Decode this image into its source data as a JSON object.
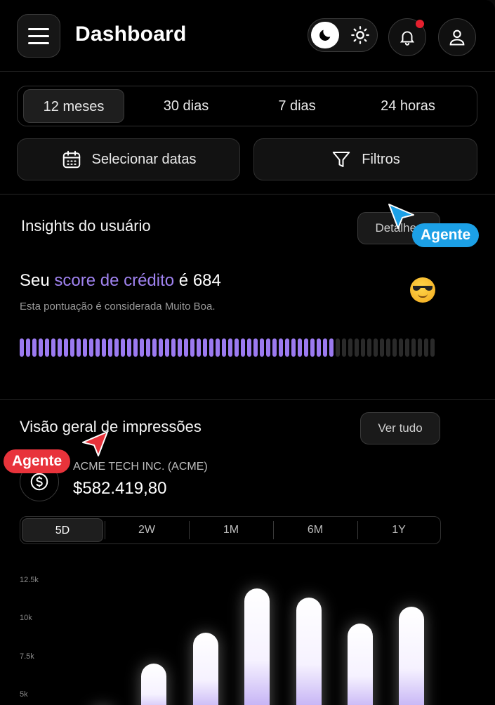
{
  "header": {
    "title": "Dashboard",
    "menu_icon": "hamburger-icon",
    "theme_icons": [
      "moon-icon",
      "sun-icon"
    ],
    "notification_icon": "bell-icon",
    "profile_icon": "user-icon"
  },
  "period_tabs": [
    {
      "label": "12 meses",
      "active": true
    },
    {
      "label": "30 dias",
      "active": false
    },
    {
      "label": "7 dias",
      "active": false
    },
    {
      "label": "24 horas",
      "active": false
    }
  ],
  "actions": {
    "select_dates": "Selecionar datas",
    "filters": "Filtros"
  },
  "insights": {
    "title": "Insights do usuário",
    "details_button": "Detalhes",
    "score_prefix": "Seu ",
    "score_highlight": "score de crédito",
    "score_suffix": " é 684",
    "score_description": "Esta pontuação é considerada Muito Boa.",
    "meter_filled_fraction": 0.76
  },
  "impressions": {
    "title": "Visão geral de impressões",
    "view_all_button": "Ver tudo",
    "company": "ACME TECH INC. (ACME)",
    "amount": "$582.419,80",
    "range_tabs": [
      {
        "label": "5D",
        "active": true
      },
      {
        "label": "2W",
        "active": false
      },
      {
        "label": "1M",
        "active": false
      },
      {
        "label": "6M",
        "active": false
      },
      {
        "label": "1Y",
        "active": false
      }
    ]
  },
  "chart_data": {
    "type": "bar",
    "y_ticks": [
      "12.5k",
      "10k",
      "7.5k",
      "5k"
    ],
    "ylim": [
      0,
      12500
    ],
    "values": [
      4100,
      6900,
      8900,
      11800,
      11200,
      9500,
      10600
    ]
  },
  "agents": [
    {
      "label": "Agente",
      "color": "#1ca0e6"
    },
    {
      "label": "Agente",
      "color": "#e8333b"
    }
  ]
}
